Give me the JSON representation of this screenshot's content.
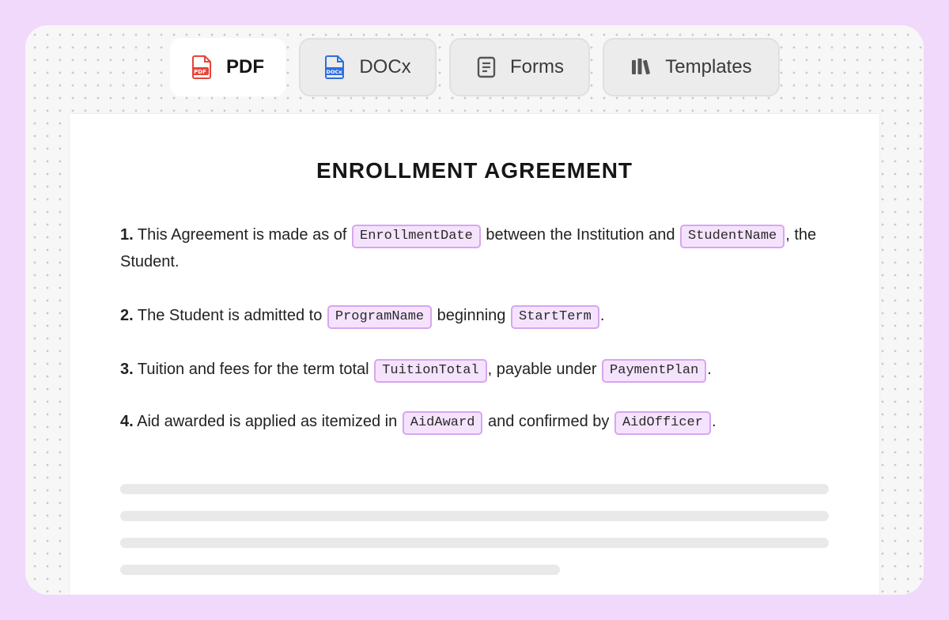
{
  "tabs": [
    {
      "label": "PDF",
      "icon": "pdf-file-icon",
      "active": true
    },
    {
      "label": "DOCx",
      "icon": "docx-file-icon",
      "active": false
    },
    {
      "label": "Forms",
      "icon": "form-document-icon",
      "active": false
    },
    {
      "label": "Templates",
      "icon": "templates-library-icon",
      "active": false
    }
  ],
  "icons": {
    "pdf_badge": "PDF",
    "docx_badge": "DOCx"
  },
  "document": {
    "title": "ENROLLMENT AGREEMENT",
    "paragraphs": [
      {
        "number": "1.",
        "t1": " This Agreement is made as of ",
        "f1": "EnrollmentDate",
        "t2": " between the Institution and ",
        "f2": "StudentName",
        "t3": ", the Student."
      },
      {
        "number": "2.",
        "t1": " The Student is admitted to ",
        "f1": "ProgramName",
        "t2": " beginning ",
        "f2": "StartTerm",
        "t3": "."
      },
      {
        "number": "3.",
        "t1": " Tuition and fees for the term total ",
        "f1": "TuitionTotal",
        "t2": ", payable under ",
        "f2": "PaymentPlan",
        "t3": "."
      },
      {
        "number": "4.",
        "t1": " Aid awarded is applied as itemized in ",
        "f1": "AidAward",
        "t2": " and confirmed by ",
        "f2": "AidOfficer",
        "t3": "."
      }
    ]
  },
  "colors": {
    "outer_background": "#f0d9fb",
    "chip_fill": "#f5e3fd",
    "chip_border": "#d6a6ef",
    "pdf_red": "#e5453a",
    "docx_blue": "#2f6fe0"
  }
}
